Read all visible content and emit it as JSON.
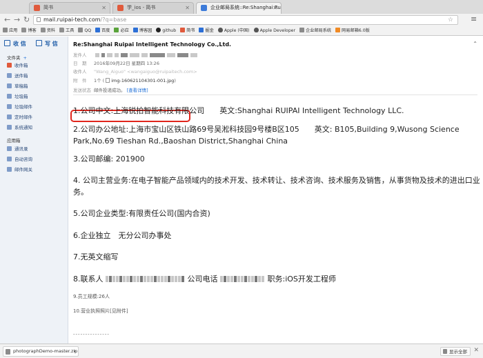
{
  "tabs": [
    {
      "title": "简书",
      "active": false
    },
    {
      "title": "学_ios - 简书",
      "active": false
    },
    {
      "title": "企业邮局系统::Re:Shanghai Rui",
      "active": true
    }
  ],
  "address": {
    "host": "mail.ruipai-tech.com",
    "path": "/?q=base"
  },
  "bookmarks": [
    "应用",
    "博客",
    "资料",
    "工具",
    "QQ",
    "百度",
    "必应",
    "博客园",
    "github",
    "简书",
    "掘金",
    "Apple (中国)",
    "Apple Developer",
    "企业邮局系统",
    "网易邮箱6.0版"
  ],
  "sidebar": {
    "receive": "收 信",
    "write": "写 信",
    "folders_label": "文件夹",
    "folders_add": "+",
    "folders": [
      "收件箱",
      "送件箱",
      "草稿箱",
      "垃圾箱",
      "垃圾邮件",
      "定时邮件",
      "系统通知"
    ],
    "apps_label": "应用箱",
    "apps": [
      "通讯录",
      "自动咨询",
      "邮件网关"
    ]
  },
  "mail": {
    "subject": "Re:Shanghai Ruipai Intelligent Technology Co.,Ltd.",
    "from_label": "发件人",
    "date_label": "日　期",
    "date_value": "2016年09月22日 星期四 13:26",
    "to_label": "收件人",
    "to_value": "\"Wang_Aiguo\" <wangaiguo@ruipaitech.com>",
    "attach_label": "附　件",
    "attach_count": "1个 (",
    "attach_file": "img-160621104301-001.jpg",
    "attach_end": ")",
    "status_label": "发送状态",
    "status_value": "邮件投递成功。",
    "status_link": "[查看详情]",
    "lines": [
      "1.公司中文:上海锐拍智能科技有限公司　　英文:Shanghai RUIPAI Intelligent Technology LLC.",
      "2.公司办公地址:上海市宝山区铁山路69号吴淞科技园9号楼B区105　　英文: B105,Building 9,Wusong Science Park,No.69 Tieshan Rd.,Baoshan District,Shanghai China",
      "3.公司邮编: 201900",
      "4. 公司主营业务:在电子智能产品领域内的技术开发、技术转让、技术咨询、技术服务及销售，从事货物及技术的进出口业务。",
      "5.公司企业类型:有限责任公司(国内合资)",
      "6.企业独立　无分公司办事处",
      "7.无英文缩写"
    ],
    "line8_contact": "8.联系人",
    "line8_phone": "公司电话",
    "line8_title": "职务:iOS开发工程师",
    "line9": "9.员工规模:26人",
    "line10": "10.营业执照照片[见附件]",
    "tail": "---------------"
  },
  "downloads": {
    "file": "photographDemo-master.zip",
    "show_all": "显示全部"
  }
}
